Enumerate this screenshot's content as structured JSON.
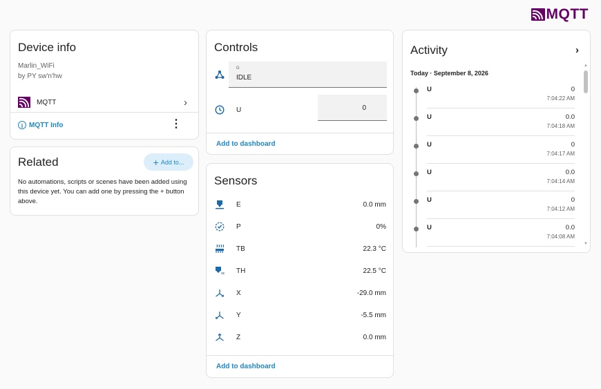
{
  "brand": {
    "name": "MQTT"
  },
  "device_info": {
    "title": "Device info",
    "model": "Marlin_WiFi",
    "manufacturer": "by PY sw'n'hw",
    "integration": "MQTT",
    "info_link": "MQTT Info"
  },
  "related": {
    "title": "Related",
    "add_button": "Add to...",
    "text": "No automations, scripts or scenes have been added using this device yet. You can add one by pressing the + button above."
  },
  "controls": {
    "title": "Controls",
    "select": {
      "label": "G",
      "value": "IDLE"
    },
    "number": {
      "label": "U",
      "value": "0"
    },
    "add_to_dashboard": "Add to dashboard"
  },
  "sensors": {
    "title": "Sensors",
    "items": [
      {
        "name": "E",
        "value": "0.0 mm",
        "icon": "extruder-icon"
      },
      {
        "name": "P",
        "value": "0%",
        "icon": "progress-check-icon"
      },
      {
        "name": "TB",
        "value": "22.3 °C",
        "icon": "heated-bed-icon"
      },
      {
        "name": "TH",
        "value": "22.5 °C",
        "icon": "hotend-temperature-icon"
      },
      {
        "name": "X",
        "value": "-29.0 mm",
        "icon": "axis-x-icon"
      },
      {
        "name": "Y",
        "value": "-5.5 mm",
        "icon": "axis-y-icon"
      },
      {
        "name": "Z",
        "value": "0.0 mm",
        "icon": "axis-z-icon"
      }
    ],
    "add_to_dashboard": "Add to dashboard"
  },
  "activity": {
    "title": "Activity",
    "date": "Today · September 8, 2026",
    "entries": [
      {
        "name": "U",
        "value": "0",
        "time": "7:04:22 AM"
      },
      {
        "name": "U",
        "value": "0.0",
        "time": "7:04:18 AM"
      },
      {
        "name": "U",
        "value": "0",
        "time": "7:04:17 AM"
      },
      {
        "name": "U",
        "value": "0.0",
        "time": "7:04:14 AM"
      },
      {
        "name": "U",
        "value": "0",
        "time": "7:04:12 AM"
      },
      {
        "name": "U",
        "value": "0.0",
        "time": "7:04:08 AM"
      }
    ]
  },
  "colors": {
    "accent": "#1e88c7",
    "brand": "#660066",
    "icon": "#1e6aa8"
  }
}
